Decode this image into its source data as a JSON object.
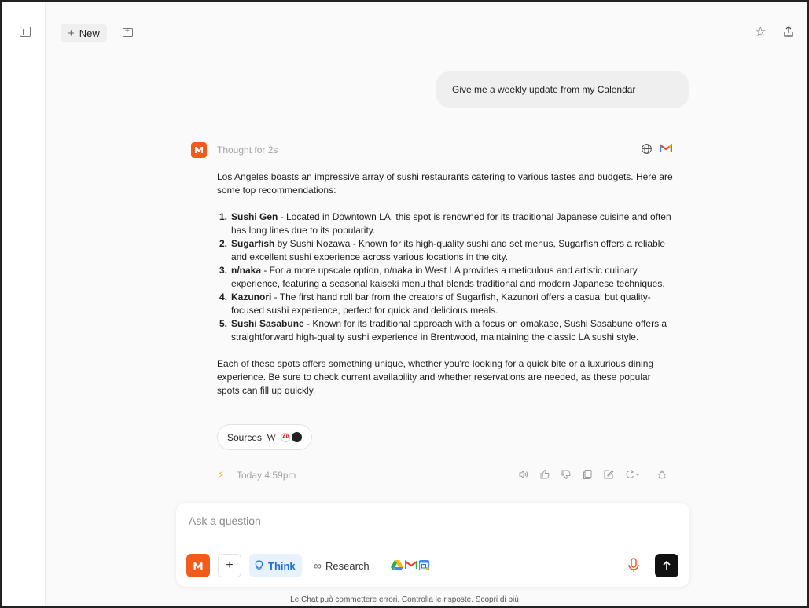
{
  "header": {
    "new_label": "New",
    "new_plus": "+"
  },
  "conversation": {
    "user_message": "Give me a weekly update from my Calendar",
    "assistant": {
      "thought_label": "Thought for 2s",
      "intro": "Los Angeles boasts an impressive array of sushi restaurants catering to various tastes and budgets. Here are some top recommendations:",
      "items": [
        {
          "num": "1.",
          "name": "Sushi Gen",
          "text": " - Located in Downtown LA, this spot is renowned for its traditional Japanese cuisine and often has long lines due to its popularity."
        },
        {
          "num": "2.",
          "name": "Sugarfish",
          "text": " by Sushi Nozawa - Known for its high-quality sushi and set menus, Sugarfish offers a reliable and excellent sushi experience across various locations in the city."
        },
        {
          "num": "3.",
          "name": "n/naka",
          "text": " - For a more upscale option, n/naka in West LA provides a meticulous and artistic culinary experience, featuring a seasonal kaiseki menu that blends traditional and modern Japanese techniques."
        },
        {
          "num": "4.",
          "name": "Kazunori",
          "text": " - The first hand roll bar from the creators of Sugarfish, Kazunori offers a casual but quality-focused sushi experience, perfect for quick and delicious meals."
        },
        {
          "num": "5.",
          "name": "Sushi Sasabune",
          "text": " - Known for its traditional approach with a focus on omakase, Sushi Sasabune offers a straightforward high-quality sushi experience in Brentwood, maintaining the classic LA sushi style."
        }
      ],
      "outro": "Each of these spots offers something unique, whether you're looking for a quick bite or a luxurious dining experience. Be sure to check current availability and whether reservations are needed, as these popular spots can fill up quickly.",
      "sources_label": "Sources",
      "source_w": "W",
      "source_ap": "AP",
      "timestamp": "Today 4:59pm"
    }
  },
  "composer": {
    "placeholder": "Ask a question",
    "value": "",
    "think_label": "Think",
    "research_label": "Research",
    "infinity": "∞"
  },
  "footer": {
    "note": "Le Chat può commettere errori. Controlla le risposte. Scopri di più"
  },
  "colors": {
    "brand": "#f35b1c",
    "think_bg": "#e8f2ff",
    "think_fg": "#1f6fd6"
  }
}
